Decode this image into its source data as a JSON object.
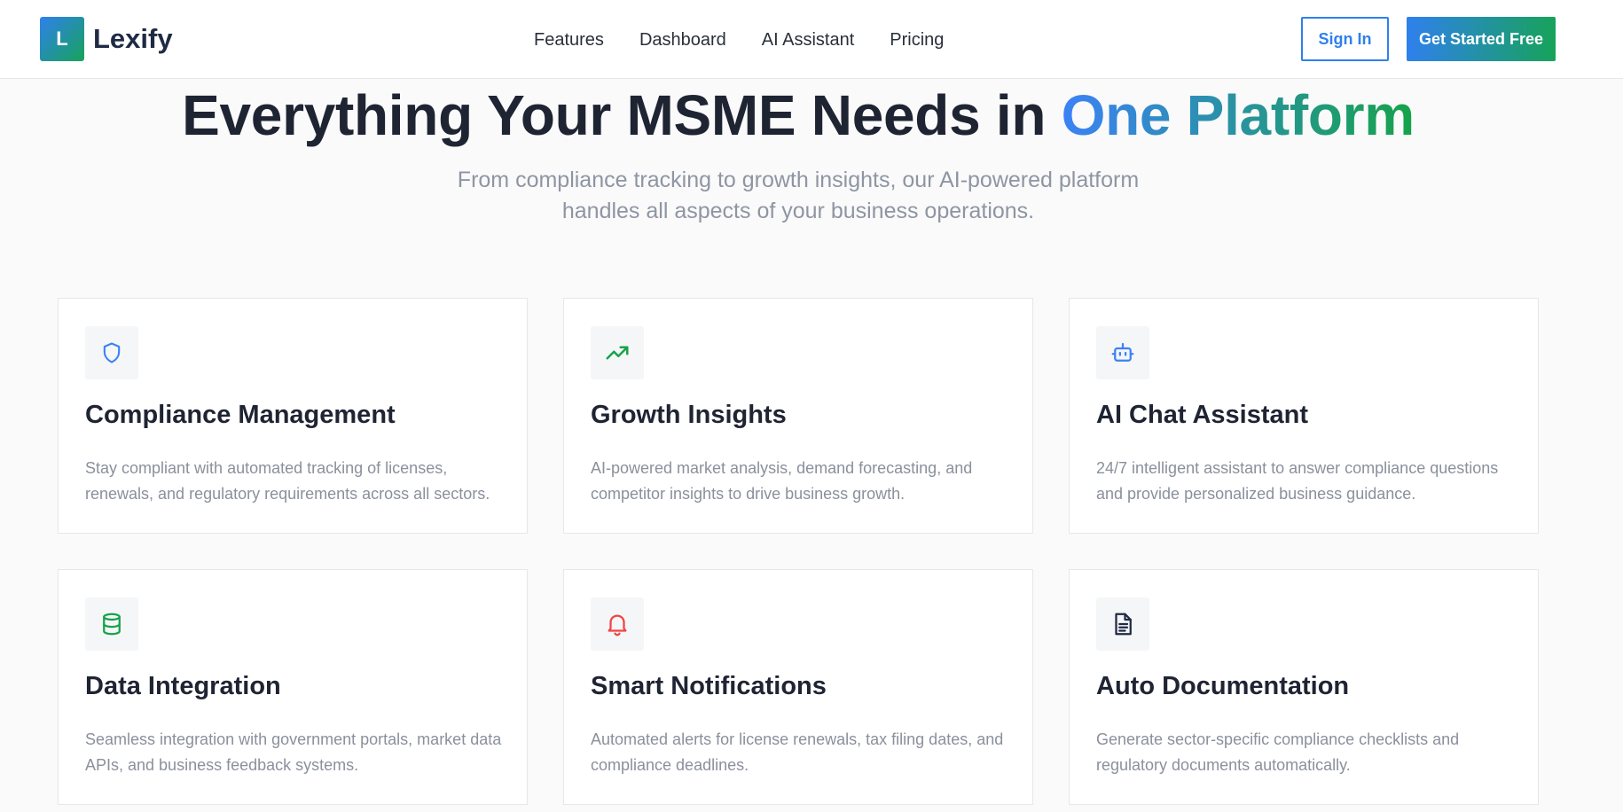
{
  "brand": {
    "logo_letter": "L",
    "name": "Lexify"
  },
  "nav": {
    "links": [
      "Features",
      "Dashboard",
      "AI Assistant",
      "Pricing"
    ],
    "signin_label": "Sign In",
    "cta_label": "Get Started Free"
  },
  "hero": {
    "title_main": "Everything Your MSME Needs in ",
    "title_accent": "One Platform",
    "subtitle_line1": "From compliance tracking to growth insights, our AI-powered platform",
    "subtitle_line2": "handles all aspects of your business operations."
  },
  "features": [
    {
      "icon": "shield-icon",
      "icon_color": "#3b82f6",
      "title": "Compliance Management",
      "desc": "Stay compliant with automated tracking of licenses, renewals, and regulatory requirements across all sectors."
    },
    {
      "icon": "trending-up-icon",
      "icon_color": "#16a34a",
      "title": "Growth Insights",
      "desc": "AI-powered market analysis, demand forecasting, and competitor insights to drive business growth."
    },
    {
      "icon": "bot-icon",
      "icon_color": "#3b82f6",
      "title": "AI Chat Assistant",
      "desc": "24/7 intelligent assistant to answer compliance questions and provide personalized business guidance."
    },
    {
      "icon": "database-icon",
      "icon_color": "#16a34a",
      "title": "Data Integration",
      "desc": "Seamless integration with government portals, market data APIs, and business feedback systems."
    },
    {
      "icon": "bell-icon",
      "icon_color": "#ef4444",
      "title": "Smart Notifications",
      "desc": "Automated alerts for license renewals, tax filing dates, and compliance deadlines."
    },
    {
      "icon": "document-icon",
      "icon_color": "#1f2a44",
      "title": "Auto Documentation",
      "desc": "Generate sector-specific compliance checklists and regulatory documents automatically."
    }
  ],
  "colors": {
    "brand_blue": "#2f80ed",
    "brand_green": "#17a35a",
    "heading": "#1f2433",
    "muted_text": "#8a909c"
  }
}
